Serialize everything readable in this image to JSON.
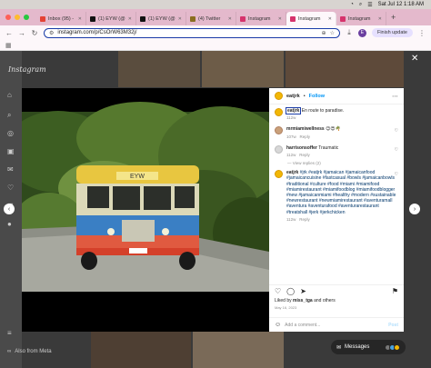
{
  "menubar": {
    "date_time": "Sat Jul 12  1:18 AM"
  },
  "tabs": [
    {
      "label": "Inbox (95) -",
      "color": "#e44134"
    },
    {
      "label": "(1) EYW (@",
      "color": "#111111"
    },
    {
      "label": "(1) EYW (@",
      "color": "#111111"
    },
    {
      "label": "(4) Twitter",
      "color": "#8a6d1f"
    },
    {
      "label": "Instagram",
      "color": "#d6336c"
    },
    {
      "label": "Instagram",
      "color": "#d6336c",
      "active": true
    },
    {
      "label": "Instagram",
      "color": "#d6336c"
    }
  ],
  "address": {
    "url": "instagram.com/p/CsOrW63M32j/",
    "finish_update": "Finish update",
    "profile_initial": "E"
  },
  "sidebar": {
    "logo": "Instagram",
    "also_from_meta": "Also from Meta"
  },
  "post": {
    "username": "eatjrk",
    "follow": "Follow",
    "caption_user": "eatjrk",
    "caption_text": "En route to paradise.",
    "caption_time": "112w",
    "comments": [
      {
        "user": "mrmiamiwellness",
        "text": "😊😍🌴",
        "time": "107w",
        "reply": "Reply"
      },
      {
        "user": "harrisonsoffer",
        "text": "Traumatic",
        "time": "112w",
        "reply": "Reply"
      },
      {
        "user": "eatjrk",
        "text": "#jrk #eatjrk #jamaican #jamaicanfood #jamaicancuisine #fastcasual #bowls #jamaicanbowls #traditional #culture #food #miami #miamifood #miamirestaurant #miamifoodblog #miamifoodblogger #new #jamaicanmiami #healthy #modern #sustainable #newrestaurant #newmiamirestaurant #aventuramall #aventura #aventurafood #aventurarestaurant #treatshall #jerk #jerkchicken",
        "time": "112w",
        "reply": "Reply"
      }
    ],
    "view_replies": "View replies (2)",
    "liked_by_prefix": "Liked by ",
    "liked_by_user": "miss_tga",
    "liked_by_suffix": " and others",
    "date": "May 16, 2023",
    "add_comment_placeholder": "Add a comment...",
    "post_button": "Post",
    "bus_sign": "EYW"
  },
  "messages": {
    "label": "Messages"
  },
  "colors": {
    "accent_blue": "#0095f6",
    "tab_bar": "#e4b9cc"
  }
}
